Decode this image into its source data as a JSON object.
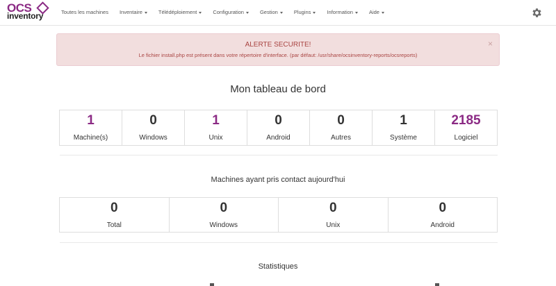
{
  "brand": {
    "line1": "OCS",
    "line2": "inventory",
    "color": "#8b2a84"
  },
  "nav": {
    "items": [
      {
        "label": "Toutes les machines",
        "dropdown": false
      },
      {
        "label": "Inventaire",
        "dropdown": true
      },
      {
        "label": "Télédéploiement",
        "dropdown": true
      },
      {
        "label": "Configuration",
        "dropdown": true
      },
      {
        "label": "Gestion",
        "dropdown": true
      },
      {
        "label": "Plugins",
        "dropdown": true
      },
      {
        "label": "Information",
        "dropdown": true
      },
      {
        "label": "Aide",
        "dropdown": true
      }
    ],
    "settings_icon": "gear-icon"
  },
  "alert": {
    "title": "ALERTE SECURITE!",
    "text": "Le fichier install.php est présent dans votre répertoire d'interface. (par défaut: /usr/share/ocsinventory-reports/ocsreports)",
    "close": "×",
    "bg": "#f2dede",
    "color": "#a94442"
  },
  "dashboard": {
    "title": "Mon tableau de bord",
    "stats": [
      {
        "value": "1",
        "label": "Machine(s)",
        "highlight": true
      },
      {
        "value": "0",
        "label": "Windows",
        "highlight": false
      },
      {
        "value": "1",
        "label": "Unix",
        "highlight": true
      },
      {
        "value": "0",
        "label": "Android",
        "highlight": false
      },
      {
        "value": "0",
        "label": "Autres",
        "highlight": false
      },
      {
        "value": "1",
        "label": "Système",
        "highlight": false
      },
      {
        "value": "2185",
        "label": "Logiciel",
        "highlight": true
      }
    ]
  },
  "contact_today": {
    "title": "Machines ayant pris contact aujourd'hui",
    "stats": [
      {
        "value": "0",
        "label": "Total"
      },
      {
        "value": "0",
        "label": "Windows"
      },
      {
        "value": "0",
        "label": "Unix"
      },
      {
        "value": "0",
        "label": "Android"
      }
    ]
  },
  "statistics": {
    "title": "Statistiques"
  }
}
